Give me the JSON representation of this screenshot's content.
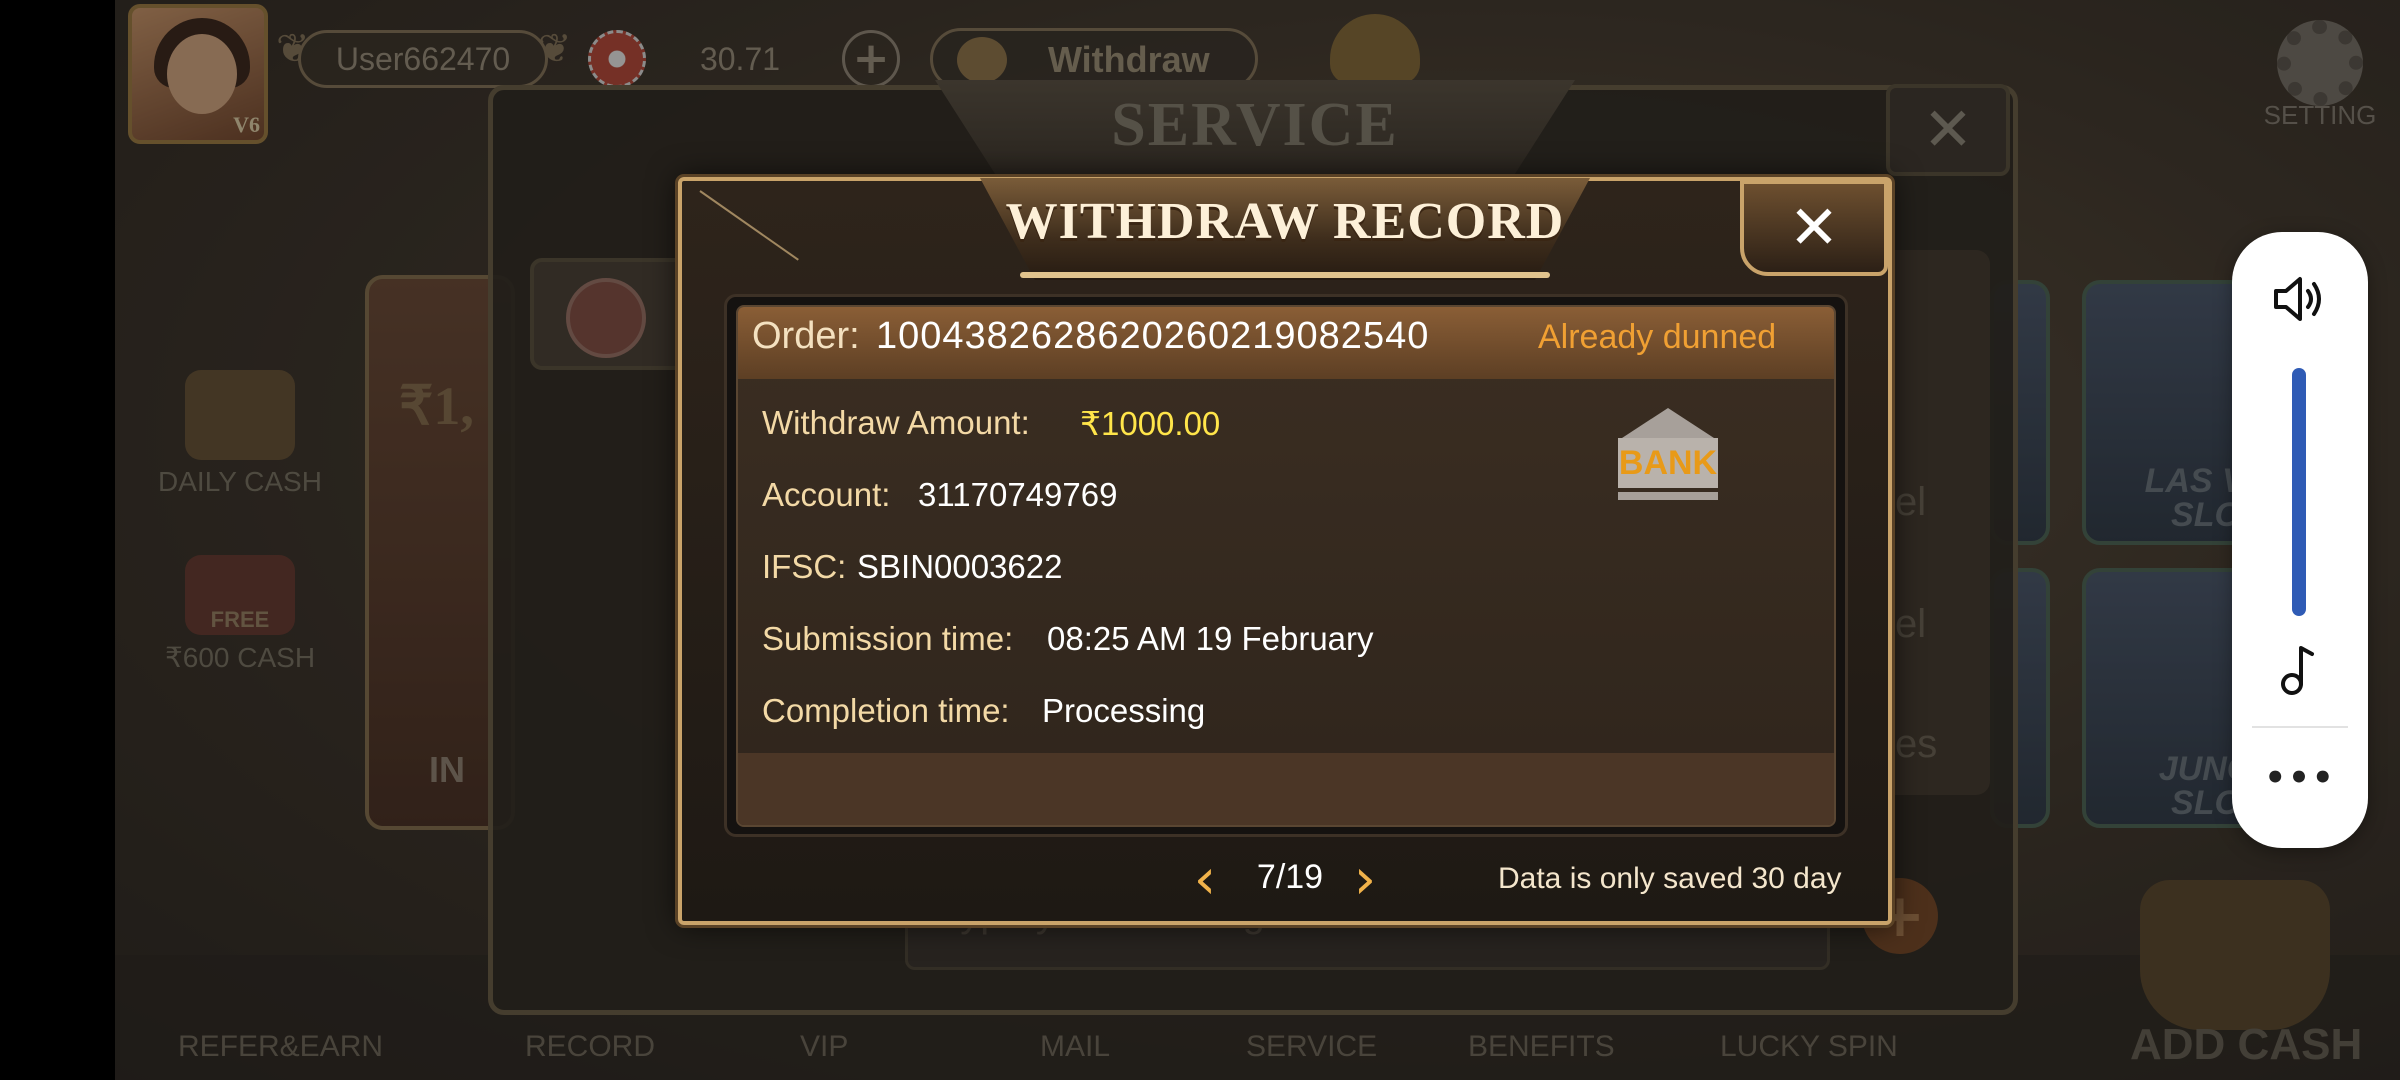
{
  "hud": {
    "username": "User662470",
    "balance": "30.71",
    "plus": "+",
    "withdraw_label": "Withdraw",
    "vip_level": "V6",
    "setting_label": "SETTING"
  },
  "side_menu": {
    "daily_cash": "DAILY CASH",
    "free_badge": "FREE",
    "free_cash": "₹600 CASH",
    "banner_amount": "₹1,",
    "banner_button": "IN"
  },
  "game_cards": [
    {
      "label_line1": "LAS VE",
      "label_line2": "SLO"
    },
    {
      "label_line1": "JUNG",
      "label_line2": "SLO"
    }
  ],
  "bottom_nav": [
    "REFER&EARN",
    "RECORD",
    "VIP",
    "MAIL",
    "SERVICE",
    "BENEFITS",
    "LUCKY SPIN",
    "ADD CASH"
  ],
  "service": {
    "title": "SERVICE",
    "close": "✕",
    "chat_placeholder": "Type your messages here...",
    "side_labels": [
      "el",
      "el",
      "es"
    ]
  },
  "withdraw_record": {
    "title": "WITHDRAW RECORD",
    "close": "✕",
    "order_label": "Order:",
    "order_id": "10043826286202602190825​40",
    "status": "Already dunned",
    "amount_label": "Withdraw Amount:",
    "amount_value": "₹1000.00",
    "account_label": "Account:",
    "account_value": "31170749769",
    "ifsc_label": "IFSC:",
    "ifsc_value": "SBIN0003622",
    "submission_label": "Submission time:",
    "submission_value": "08:25 AM 19 February",
    "completion_label": "Completion time:",
    "completion_value": "Processing",
    "bank_badge": "BANK",
    "prev": "‹",
    "next": "›",
    "page_indicator": "7/19",
    "retention_note": "Data is only saved 30 day"
  },
  "volume_panel": {
    "level_percent": 100,
    "more": "•••"
  },
  "colors": {
    "status_orange": "#f0a033",
    "amount_yellow": "#ffe54a",
    "gold_border": "#c9a36a",
    "volume_blue": "#2f5bb5"
  },
  "icons": [
    "speaker-icon",
    "music-note-icon",
    "bank-icon",
    "gear-icon",
    "chevron-left-icon",
    "chevron-right-icon",
    "close-icon"
  ]
}
